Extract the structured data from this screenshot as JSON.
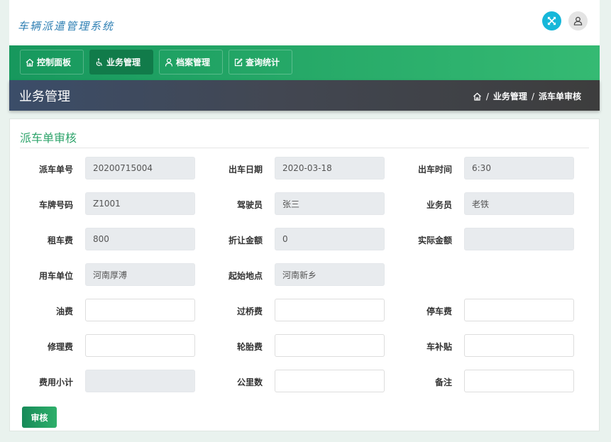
{
  "app": {
    "title": "车辆派遣管理系统"
  },
  "nav": {
    "items": [
      {
        "label": "控制面板",
        "icon": "home-icon"
      },
      {
        "label": "业务管理",
        "icon": "accessibility-icon"
      },
      {
        "label": "档案管理",
        "icon": "user-icon"
      },
      {
        "label": "查询统计",
        "icon": "edit-icon"
      }
    ],
    "active": "业务管理"
  },
  "page": {
    "title": "业务管理",
    "breadcrumb": [
      "业务管理",
      "派车单审核"
    ]
  },
  "form": {
    "title": "派车单审核",
    "fields": {
      "order_no": {
        "label": "派车单号",
        "value": "20200715004"
      },
      "out_date": {
        "label": "出车日期",
        "value": "2020-03-18"
      },
      "out_time": {
        "label": "出车时间",
        "value": "6:30"
      },
      "plate_no": {
        "label": "车牌号码",
        "value": "Z1001"
      },
      "driver": {
        "label": "驾驶员",
        "value": "张三"
      },
      "salesman": {
        "label": "业务员",
        "value": "老铁"
      },
      "rent_fee": {
        "label": "租车费",
        "value": "800"
      },
      "discount": {
        "label": "折让金额",
        "value": "0"
      },
      "actual_amount": {
        "label": "实际金额",
        "value": ""
      },
      "unit": {
        "label": "用车单位",
        "value": "河南厚溥"
      },
      "start_place": {
        "label": "起始地点",
        "value": "河南新乡"
      },
      "fuel_fee": {
        "label": "油费",
        "value": ""
      },
      "toll_fee": {
        "label": "过桥费",
        "value": ""
      },
      "parking_fee": {
        "label": "停车费",
        "value": ""
      },
      "repair_fee": {
        "label": "修理费",
        "value": ""
      },
      "tire_fee": {
        "label": "轮胎费",
        "value": ""
      },
      "subsidy": {
        "label": "车补贴",
        "value": ""
      },
      "subtotal": {
        "label": "费用小计",
        "value": ""
      },
      "mileage": {
        "label": "公里数",
        "value": ""
      },
      "remark": {
        "label": "备注",
        "value": ""
      }
    },
    "submit_label": "审核"
  },
  "colors": {
    "accent": "#2ea46b",
    "nav_start": "#17985d",
    "nav_end": "#35ba73",
    "expand_button": "#17b7d9"
  }
}
